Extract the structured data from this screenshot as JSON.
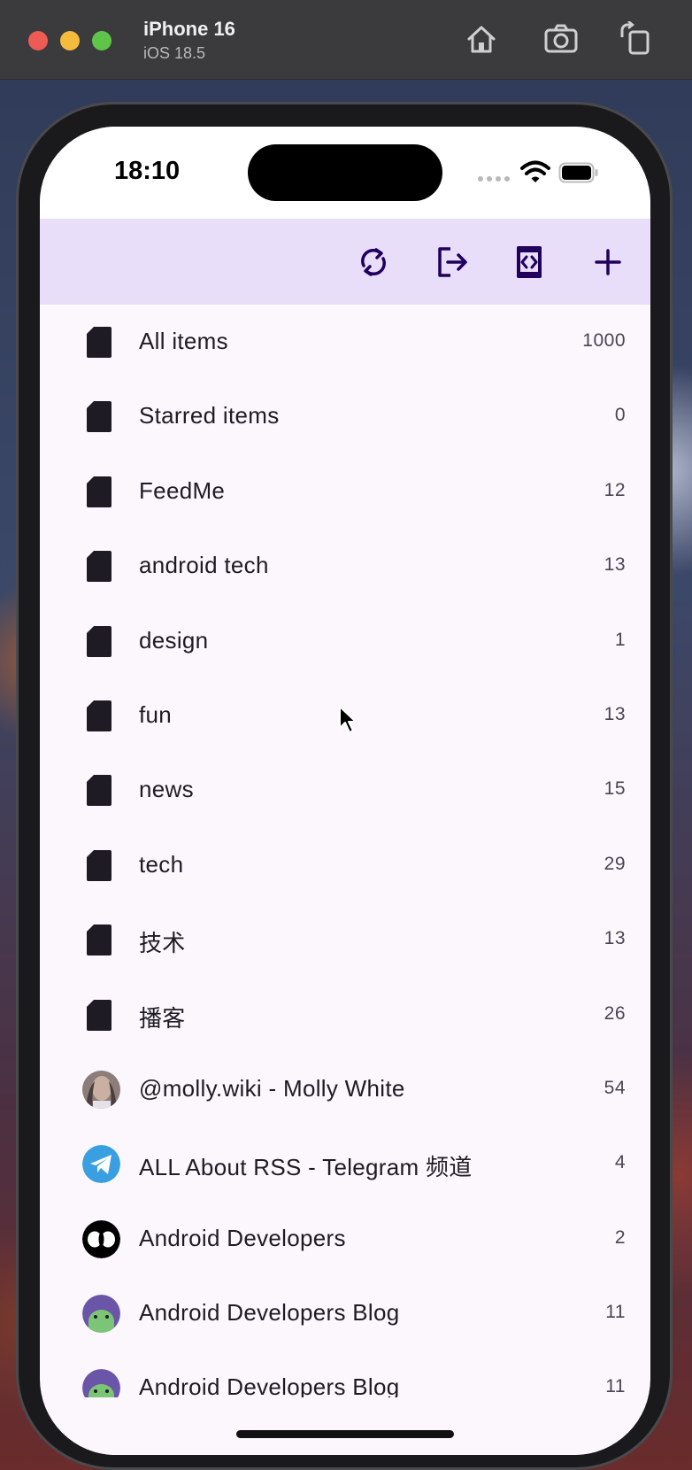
{
  "simulator": {
    "device_name": "iPhone 16",
    "os_version": "iOS 18.5"
  },
  "status_bar": {
    "time": "18:10"
  },
  "toolbar": {
    "icons": [
      "sync-icon",
      "logout-icon",
      "code-icon",
      "add-icon"
    ],
    "background": "#e8defa",
    "icon_color": "#21005d"
  },
  "feeds": [
    {
      "label": "All items",
      "count": "1000",
      "kind": "folder"
    },
    {
      "label": "Starred items",
      "count": "0",
      "kind": "folder"
    },
    {
      "label": "FeedMe",
      "count": "12",
      "kind": "folder"
    },
    {
      "label": "android tech",
      "count": "13",
      "kind": "folder"
    },
    {
      "label": "design",
      "count": "1",
      "kind": "folder"
    },
    {
      "label": "fun",
      "count": "13",
      "kind": "folder"
    },
    {
      "label": "news",
      "count": "15",
      "kind": "folder"
    },
    {
      "label": "tech",
      "count": "29",
      "kind": "folder"
    },
    {
      "label": "技术",
      "count": "13",
      "kind": "folder"
    },
    {
      "label": "播客",
      "count": "26",
      "kind": "folder"
    },
    {
      "label": "@molly.wiki - Molly White",
      "count": "54",
      "kind": "avatar-photo"
    },
    {
      "label": "ALL About RSS - Telegram 频道",
      "count": "4",
      "kind": "avatar-telegram"
    },
    {
      "label": "Android Developers",
      "count": "2",
      "kind": "avatar-dark"
    },
    {
      "label": "Android Developers Blog",
      "count": "11",
      "kind": "avatar-android"
    },
    {
      "label": "Android Developers Blog",
      "count": "11",
      "kind": "avatar-android"
    }
  ],
  "colors": {
    "list_background": "#fbf7fd",
    "folder_icon": "#1f1b24"
  }
}
